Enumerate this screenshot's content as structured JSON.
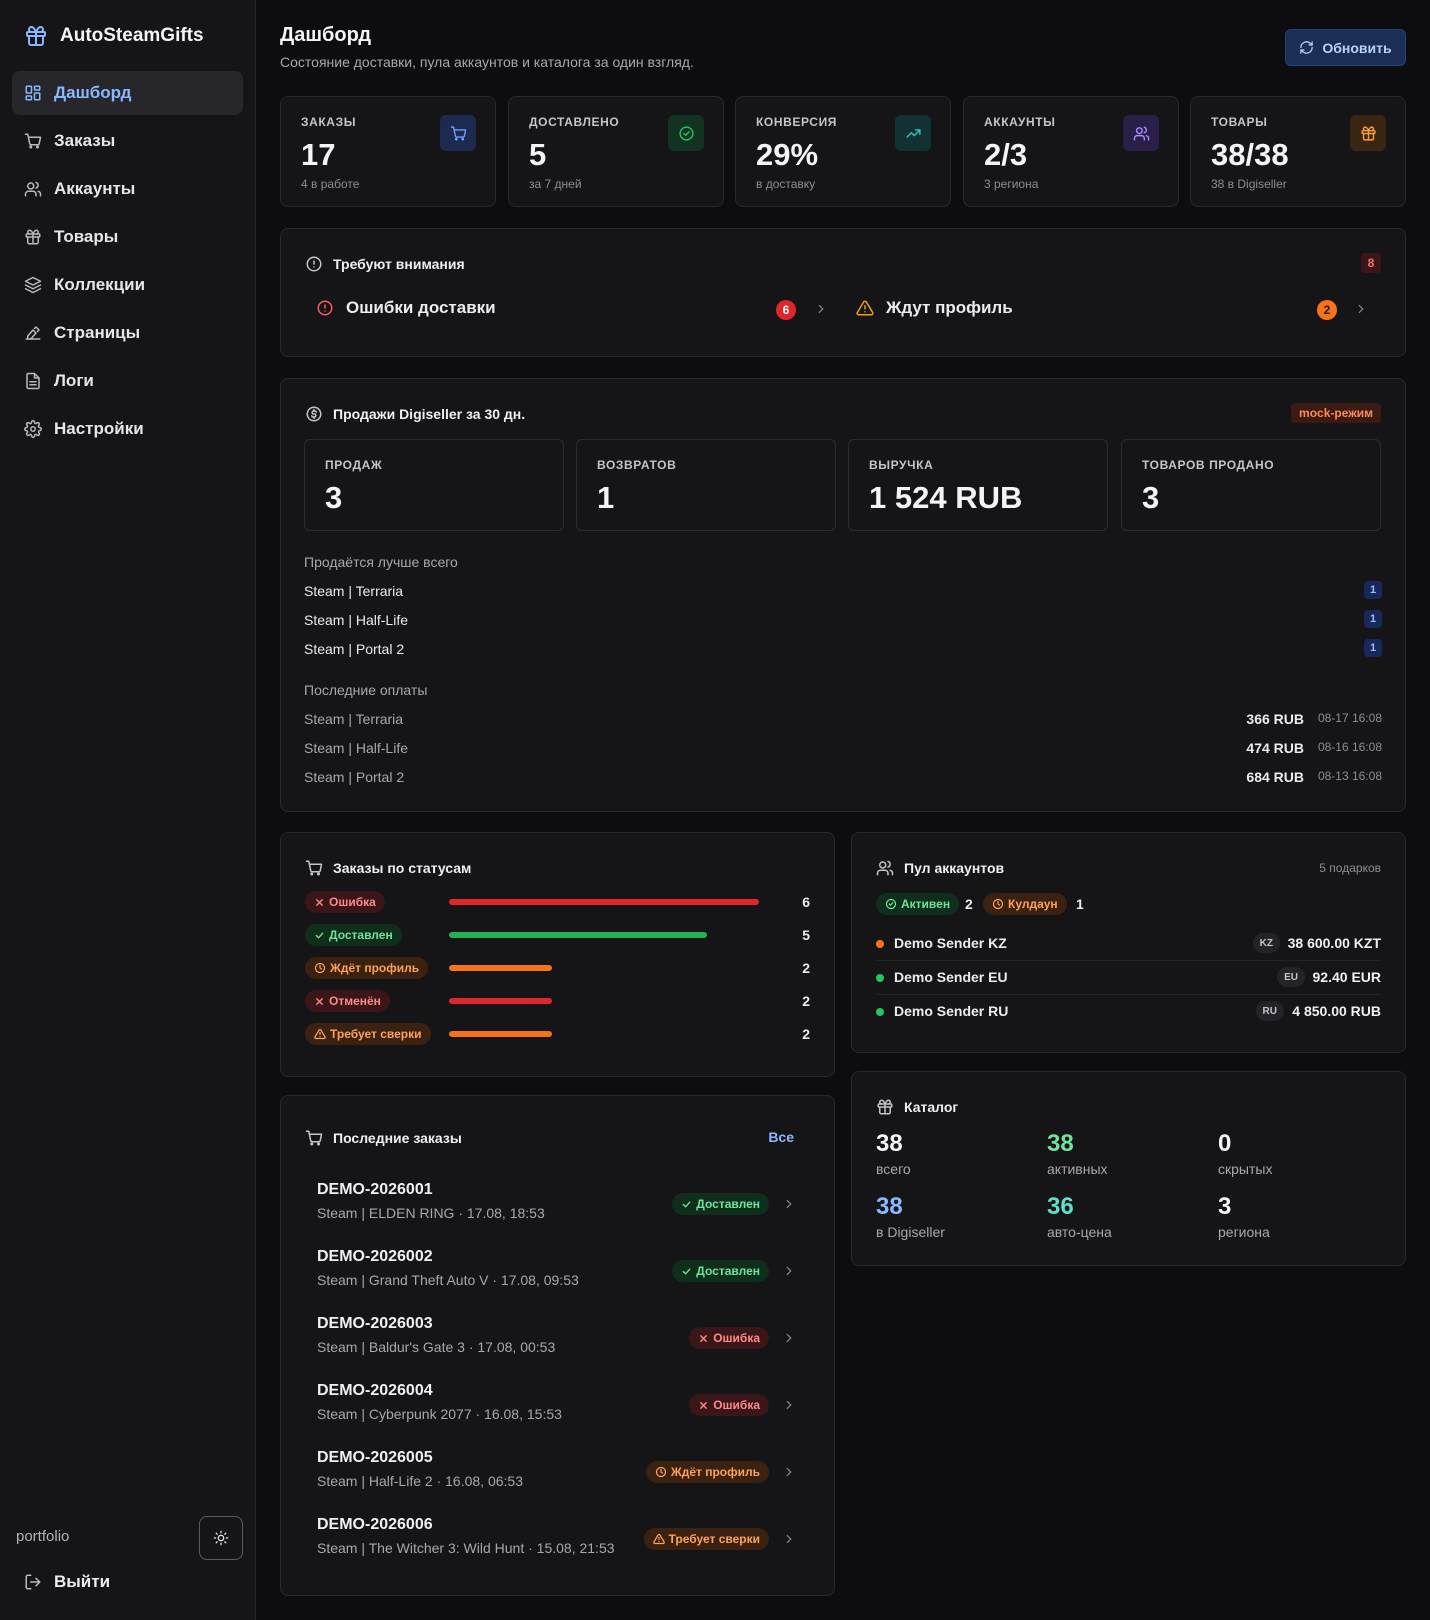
{
  "app": {
    "name": "AutoSteamGifts"
  },
  "nav": [
    {
      "label": "Дашборд",
      "icon": "dashboard-icon",
      "active": true
    },
    {
      "label": "Заказы",
      "icon": "cart-icon"
    },
    {
      "label": "Аккаунты",
      "icon": "users-icon"
    },
    {
      "label": "Товары",
      "icon": "gift-icon"
    },
    {
      "label": "Коллекции",
      "icon": "layers-icon"
    },
    {
      "label": "Страницы",
      "icon": "page-builder-icon"
    },
    {
      "label": "Логи",
      "icon": "file-text-icon"
    },
    {
      "label": "Настройки",
      "icon": "gear-icon"
    }
  ],
  "sidebar_bottom": {
    "label": "portfolio",
    "logout_label": "Выйти"
  },
  "header": {
    "title": "Дашборд",
    "subtitle": "Состояние доставки, пула аккаунтов и каталога за один взгляд.",
    "refresh_label": "Обновить"
  },
  "stats": [
    {
      "label": "ЗАКАЗЫ",
      "value": "17",
      "hint": "4 в работе",
      "icon": "cart-icon",
      "color": "#5b8cff"
    },
    {
      "label": "ДОСТАВЛЕНО",
      "value": "5",
      "hint": "за 7 дней",
      "icon": "check-circle-icon",
      "color": "#22c55e"
    },
    {
      "label": "КОНВЕРСИЯ",
      "value": "29%",
      "hint": "в доставку",
      "icon": "trending-up-icon",
      "color": "#2bb6b6"
    },
    {
      "label": "АККАУНТЫ",
      "value": "2/3",
      "hint": "3 региона",
      "icon": "users-icon",
      "color": "#9b7bff"
    },
    {
      "label": "ТОВАРЫ",
      "value": "38/38",
      "hint": "38 в Digiseller",
      "icon": "gift-icon",
      "color": "#f59e42"
    }
  ],
  "attention": {
    "title": "Требуют внимания",
    "total": "8",
    "items": [
      {
        "label": "Ошибки доставки",
        "count": "6"
      },
      {
        "label": "Ждут профиль",
        "count": "2"
      }
    ]
  },
  "sales": {
    "title": "Продажи Digiseller за 30 дн.",
    "mode_badge": "mock-режим",
    "metrics": [
      {
        "label": "ПРОДАЖ",
        "value": "3"
      },
      {
        "label": "ВОЗВРАТОВ",
        "value": "1"
      },
      {
        "label": "ВЫРУЧКА",
        "value": "1 524 RUB"
      },
      {
        "label": "ТОВАРОВ ПРОДАНО",
        "value": "3"
      }
    ],
    "best_label": "Продаётся лучше всего",
    "best": [
      {
        "name": "Steam | Terraria",
        "count": "1"
      },
      {
        "name": "Steam | Half-Life",
        "count": "1"
      },
      {
        "name": "Steam | Portal 2",
        "count": "1"
      }
    ],
    "payments_label": "Последние оплаты",
    "payments": [
      {
        "name": "Steam | Terraria",
        "amount": "366 RUB",
        "date": "08-17 16:08"
      },
      {
        "name": "Steam | Half-Life",
        "amount": "474 RUB",
        "date": "08-16 16:08"
      },
      {
        "name": "Steam | Portal 2",
        "amount": "684 RUB",
        "date": "08-13 16:08"
      }
    ]
  },
  "order_statuses": {
    "title": "Заказы по статусам",
    "items": [
      {
        "label": "Ошибка",
        "count": 6,
        "kind": "red",
        "icon": "x-icon",
        "bar_color": "#e0262b"
      },
      {
        "label": "Доставлен",
        "count": 5,
        "kind": "green",
        "icon": "check-icon",
        "bar_color": "#22b253"
      },
      {
        "label": "Ждёт профиль",
        "count": 2,
        "kind": "orange",
        "icon": "clock-icon",
        "bar_color": "#f97316"
      },
      {
        "label": "Отменён",
        "count": 2,
        "kind": "red",
        "icon": "x-icon",
        "bar_color": "#e0262b"
      },
      {
        "label": "Требует сверки",
        "count": 2,
        "kind": "orange",
        "icon": "warning-icon",
        "bar_color": "#f97316"
      }
    ]
  },
  "accounts_pool": {
    "title": "Пул аккаунтов",
    "gifts_hint": "5 подарков",
    "active_label": "Активен",
    "active_count": "2",
    "cooldown_label": "Кулдаун",
    "cooldown_count": "1",
    "accounts": [
      {
        "name": "Demo Sender KZ",
        "region": "KZ",
        "balance": "38 600.00 KZT",
        "dot": "#f97316"
      },
      {
        "name": "Demo Sender EU",
        "region": "EU",
        "balance": "92.40 EUR",
        "dot": "#22c55e"
      },
      {
        "name": "Demo Sender RU",
        "region": "RU",
        "balance": "4 850.00 RUB",
        "dot": "#22c55e"
      }
    ]
  },
  "catalog": {
    "title": "Каталог",
    "cells": [
      {
        "value": "38",
        "label": "всего",
        "color": "#f4f4f6"
      },
      {
        "value": "38",
        "label": "активных",
        "color": "#6fe39a"
      },
      {
        "value": "0",
        "label": "скрытых",
        "color": "#f4f4f6"
      },
      {
        "value": "38",
        "label": "в Digiseller",
        "color": "#8ab8ff"
      },
      {
        "value": "36",
        "label": "авто-цена",
        "color": "#5ee0c8"
      },
      {
        "value": "3",
        "label": "региона",
        "color": "#f4f4f6"
      }
    ]
  },
  "recent_orders": {
    "title": "Последние заказы",
    "all_label": "Все",
    "orders": [
      {
        "id": "DEMO-2026001",
        "desc": "Steam | ELDEN RING · 17.08, 18:53",
        "status": "Доставлен",
        "kind": "green",
        "icon": "check-icon"
      },
      {
        "id": "DEMO-2026002",
        "desc": "Steam | Grand Theft Auto V · 17.08, 09:53",
        "status": "Доставлен",
        "kind": "green",
        "icon": "check-icon"
      },
      {
        "id": "DEMO-2026003",
        "desc": "Steam | Baldur's Gate 3 · 17.08, 00:53",
        "status": "Ошибка",
        "kind": "red",
        "icon": "x-icon"
      },
      {
        "id": "DEMO-2026004",
        "desc": "Steam | Cyberpunk 2077 · 16.08, 15:53",
        "status": "Ошибка",
        "kind": "red",
        "icon": "x-icon"
      },
      {
        "id": "DEMO-2026005",
        "desc": "Steam | Half-Life 2 · 16.08, 06:53",
        "status": "Ждёт профиль",
        "kind": "orange",
        "icon": "clock-icon"
      },
      {
        "id": "DEMO-2026006",
        "desc": "Steam | The Witcher 3: Wild Hunt · 15.08, 21:53",
        "status": "Требует сверки",
        "kind": "orange",
        "icon": "warning-icon"
      }
    ]
  }
}
